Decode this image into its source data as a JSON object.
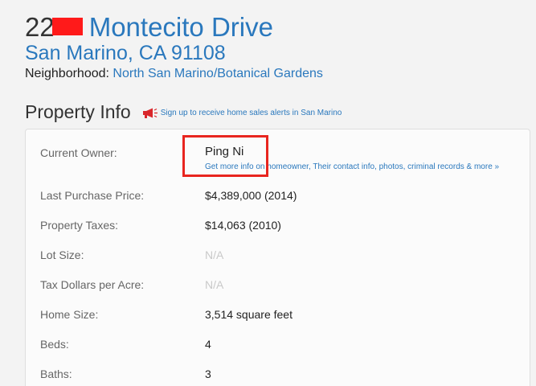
{
  "address": {
    "house_number_visible": "22",
    "street": "Montecito Drive",
    "city_state_zip": "San Marino, CA 91108",
    "neighborhood_label": "Neighborhood:",
    "neighborhood": "North San Marino/Botanical Gardens"
  },
  "section": {
    "title": "Property Info",
    "alert_link": "Sign up to receive home sales alerts in San Marino"
  },
  "property": {
    "owner_label": "Current Owner:",
    "owner_value": "Ping Ni",
    "owner_more_link": "Get more info on homeowner, Their contact info, photos, criminal records & more »",
    "rows": [
      {
        "label": "Last Purchase Price:",
        "value": "$4,389,000 (2014)"
      },
      {
        "label": "Property Taxes:",
        "value": "$14,063 (2010)"
      },
      {
        "label": "Lot Size:",
        "value": "N/A"
      },
      {
        "label": "Tax Dollars per Acre:",
        "value": "N/A"
      },
      {
        "label": "Home Size:",
        "value": "3,514 square feet"
      },
      {
        "label": "Beds:",
        "value": "4"
      },
      {
        "label": "Baths:",
        "value": "3"
      }
    ]
  },
  "colors": {
    "link": "#2a78bd",
    "redaction": "#ff1a1a",
    "highlight": "#e8251f"
  }
}
